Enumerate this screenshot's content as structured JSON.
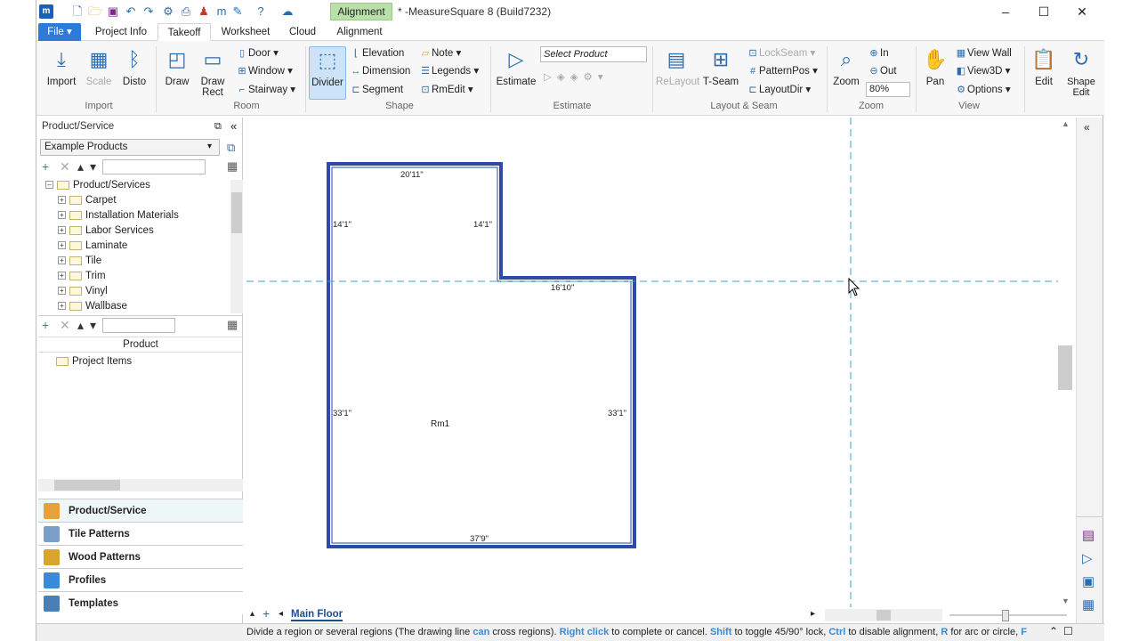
{
  "titlebar": {
    "context_tab": "Alignment",
    "title": "* -MeasureSquare 8 (Build7232)"
  },
  "tabs": [
    "File ▾",
    "Project Info",
    "Takeoff",
    "Worksheet",
    "Cloud",
    "Alignment"
  ],
  "ribbon": {
    "import": "Import",
    "scale": "Scale",
    "disto": "Disto",
    "draw": "Draw",
    "draw_rect": "Draw Rect",
    "door": "Door",
    "window": "Window",
    "stairway": "Stairway",
    "divider": "Divider",
    "elevation": "Elevation",
    "dimension": "Dimension",
    "segment": "Segment",
    "note": "Note",
    "legends": "Legends",
    "rmedit": "RmEdit",
    "estimate": "Estimate",
    "select_product": "Select Product",
    "relayout": "ReLayout",
    "tseam": "T-Seam",
    "lockseam": "LockSeam",
    "patternpos": "PatternPos",
    "layoutdir": "LayoutDir",
    "zoom": "Zoom",
    "in": "In",
    "out": "Out",
    "zoom_level": "80%",
    "pan": "Pan",
    "view_wall": "View Wall",
    "view3d": "View3D",
    "options": "Options",
    "edit": "Edit",
    "shape_edit": "Shape Edit",
    "groups": {
      "import": "Import",
      "room": "Room",
      "shape": "Shape",
      "estimate": "Estimate",
      "layout": "Layout & Seam",
      "zoom": "Zoom",
      "view": "View"
    }
  },
  "panel": {
    "title": "Product/Service",
    "combo": "Example Products",
    "tree_root": "Product/Services",
    "tree": [
      "Carpet",
      "Installation Materials",
      "Labor Services",
      "Laminate",
      "Tile",
      "Trim",
      "Vinyl",
      "Wallbase"
    ],
    "product_header": "Product",
    "project_items": "Project Items",
    "accordion": [
      "Product/Service",
      "Tile Patterns",
      "Wood Patterns",
      "Profiles",
      "Templates"
    ]
  },
  "drawing": {
    "room": "Rm1",
    "dims": {
      "top": "20'11\"",
      "left_upper": "14'1\"",
      "inner_upper": "14'1\"",
      "step": "16'10\"",
      "left_lower": "33'1\"",
      "right_lower": "33'1\"",
      "bottom": "37'9\""
    }
  },
  "floor_tab": "Main Floor",
  "status": {
    "p1": "Divide a region or several regions (The drawing line ",
    "h1": "can",
    "p2": " cross regions). ",
    "h2": "Right click",
    "p3": " to complete or cancel. ",
    "h3": "Shift",
    "p4": " to toggle 45/90° lock, ",
    "h4": "Ctrl",
    "p5": " to disable alignment, ",
    "h5": "R",
    "p6": " for arc or circle, ",
    "h6": "F"
  }
}
